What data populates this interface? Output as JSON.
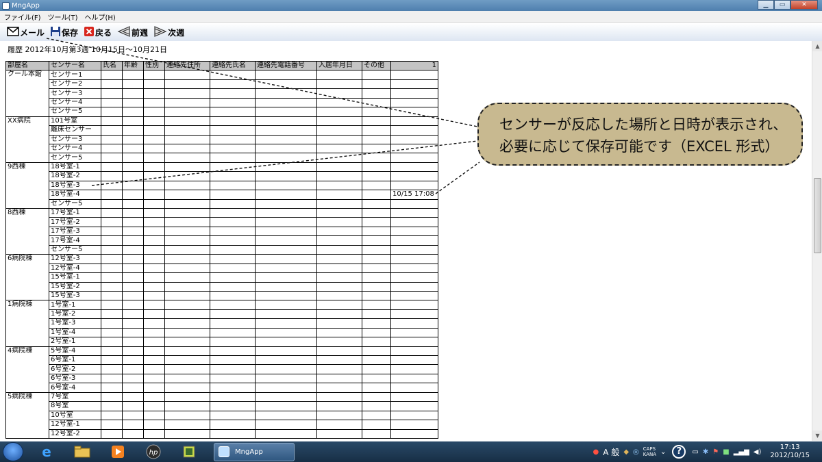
{
  "window": {
    "title": "MngApp"
  },
  "menu": [
    "ファイル(F)",
    "ツール(T)",
    "ヘルプ(H)"
  ],
  "toolbar": {
    "mail_label": "メール",
    "save_label": "保存",
    "back_label": "戻る",
    "prev_week_label": "前週",
    "next_week_label": "次週"
  },
  "history": {
    "text": "履歴 2012年10月第3週 10月15日～10月21日"
  },
  "table": {
    "headers": [
      "部屋名",
      "センサー名",
      "氏名",
      "年齢",
      "性別",
      "連絡先住所",
      "連絡先氏名",
      "連絡先電話番号",
      "入居年月日",
      "その他",
      "1"
    ],
    "groups": [
      {
        "room": "クール本館",
        "sensors": [
          "センサー1",
          "センサー2",
          "センサー3",
          "センサー4",
          "センサー5"
        ]
      },
      {
        "room": "XX病院",
        "sensors": [
          "101号室",
          "離床センサー",
          "センサー3",
          "センサー4",
          "センサー5"
        ]
      },
      {
        "room": "9西棟",
        "sensors": [
          "18号室-1",
          "18号室-2",
          "18号室-3",
          "18号室-4",
          "センサー5"
        ]
      },
      {
        "room": "8西棟",
        "sensors": [
          "17号室-1",
          "17号室-2",
          "17号室-3",
          "17号室-4",
          "センサー5"
        ]
      },
      {
        "room": "6病院棟",
        "sensors": [
          "12号室-3",
          "12号室-4",
          "15号室-1",
          "15号室-2",
          "15号室-3"
        ]
      },
      {
        "room": "1病院棟",
        "sensors": [
          "1号室-1",
          "1号室-2",
          "1号室-3",
          "1号室-4",
          "2号室-1"
        ]
      },
      {
        "room": "4病院棟",
        "sensors": [
          "5号室-4",
          "6号室-1",
          "6号室-2",
          "6号室-3",
          "6号室-4"
        ]
      },
      {
        "room": "5病院棟",
        "sensors": [
          "7号室",
          "8号室",
          "10号室",
          "12号室-1",
          "12号室-2"
        ]
      }
    ],
    "timestamp": {
      "group": 2,
      "row": 3,
      "value": "10/15 17:08"
    }
  },
  "callout": {
    "line1": "センサーが反応した場所と日時が表示され、",
    "line2": "必要に応じて保存可能です（EXCEL 形式）"
  },
  "taskbar": {
    "active_task_label": "MngApp",
    "ime_label": "A 般",
    "caps_label": "CAPS",
    "kana_label": "KANA",
    "help_label": "?",
    "clock_time": "17:13",
    "clock_date": "2012/10/15"
  },
  "colors": {
    "callout_fill": "#c8b990",
    "header_fill": "#c4c4c4",
    "titlebar": "#5a87b6",
    "taskbar": "#1f3a56"
  }
}
